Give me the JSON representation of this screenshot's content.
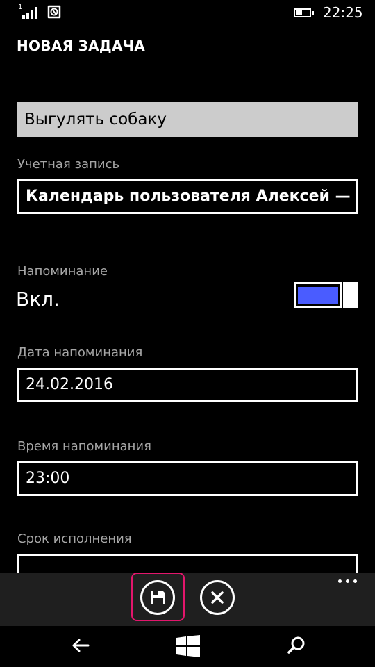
{
  "status_bar": {
    "signal_label": "1",
    "clock": "22:25",
    "icons": [
      "signal-icon",
      "sync-icon",
      "battery-icon"
    ]
  },
  "page": {
    "title": "НОВАЯ ЗАДАЧА"
  },
  "task": {
    "title_value": "Выгулять собаку"
  },
  "account": {
    "label": "Учетная запись",
    "value": "Календарь пользователя Алексей — Outl"
  },
  "reminder": {
    "label": "Напоминание",
    "state": "Вкл.",
    "on": true
  },
  "reminder_date": {
    "label": "Дата напоминания",
    "value": "24.02.2016"
  },
  "reminder_time": {
    "label": "Время напоминания",
    "value": "23:00"
  },
  "due_date": {
    "label": "Срок исполнения",
    "value": ""
  },
  "app_bar": {
    "buttons": [
      "save-icon",
      "cancel-icon"
    ],
    "more": "more-icon"
  },
  "nav_bar": {
    "buttons": [
      "back-arrow-icon",
      "windows-start-icon",
      "search-icon"
    ]
  },
  "colors": {
    "accent": "#4a5cff",
    "highlight": "#e3166c",
    "input_bg": "#cccccc",
    "app_bar_bg": "#1f1f1f",
    "label": "#a6a6a6"
  }
}
